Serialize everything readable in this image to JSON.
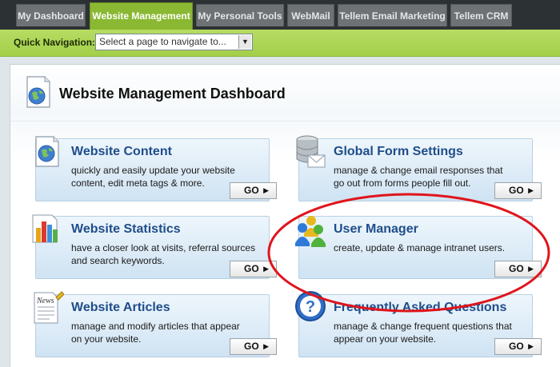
{
  "tabs": [
    {
      "label": "My Dashboard",
      "active": false
    },
    {
      "label": "Website Management",
      "active": true
    },
    {
      "label": "My Personal Tools",
      "active": false
    },
    {
      "label": "WebMail",
      "active": false
    },
    {
      "label": "Tellem Email Marketing",
      "active": false
    },
    {
      "label": "Tellem CRM",
      "active": false
    }
  ],
  "quick_nav": {
    "label": "Quick Navigation:",
    "select_value": "Select a page to navigate to..."
  },
  "dashboard": {
    "title": "Website Management Dashboard"
  },
  "cards": [
    {
      "title": "Website Content",
      "line1": "quickly and easily update your website",
      "line2": "content, edit meta tags & more.",
      "go": "GO",
      "icon": "globe-document-icon"
    },
    {
      "title": "Global Form Settings",
      "line1": "manage & change email responses that",
      "line2": "go out from forms people fill out.",
      "go": "GO",
      "icon": "database-envelope-icon"
    },
    {
      "title": "Website Statistics",
      "line1": "have a closer look at visits, referral sources",
      "line2": "and search keywords.",
      "go": "GO",
      "icon": "bar-chart-icon"
    },
    {
      "title": "User Manager",
      "line1": "create, update & manage intranet users.",
      "line2": "",
      "go": "GO",
      "icon": "users-icon"
    },
    {
      "title": "Website Articles",
      "line1": "manage and modify articles that appear",
      "line2": "on your website.",
      "go": "GO",
      "icon": "news-icon"
    },
    {
      "title": "Frequently Asked Questions",
      "line1": "manage & change frequent questions that",
      "line2": "appear on your website.",
      "go": "GO",
      "icon": "question-icon"
    }
  ],
  "colors": {
    "active_tab": "#8ab832",
    "card_title": "#1f4d8a",
    "annotation": "#e0141b"
  }
}
